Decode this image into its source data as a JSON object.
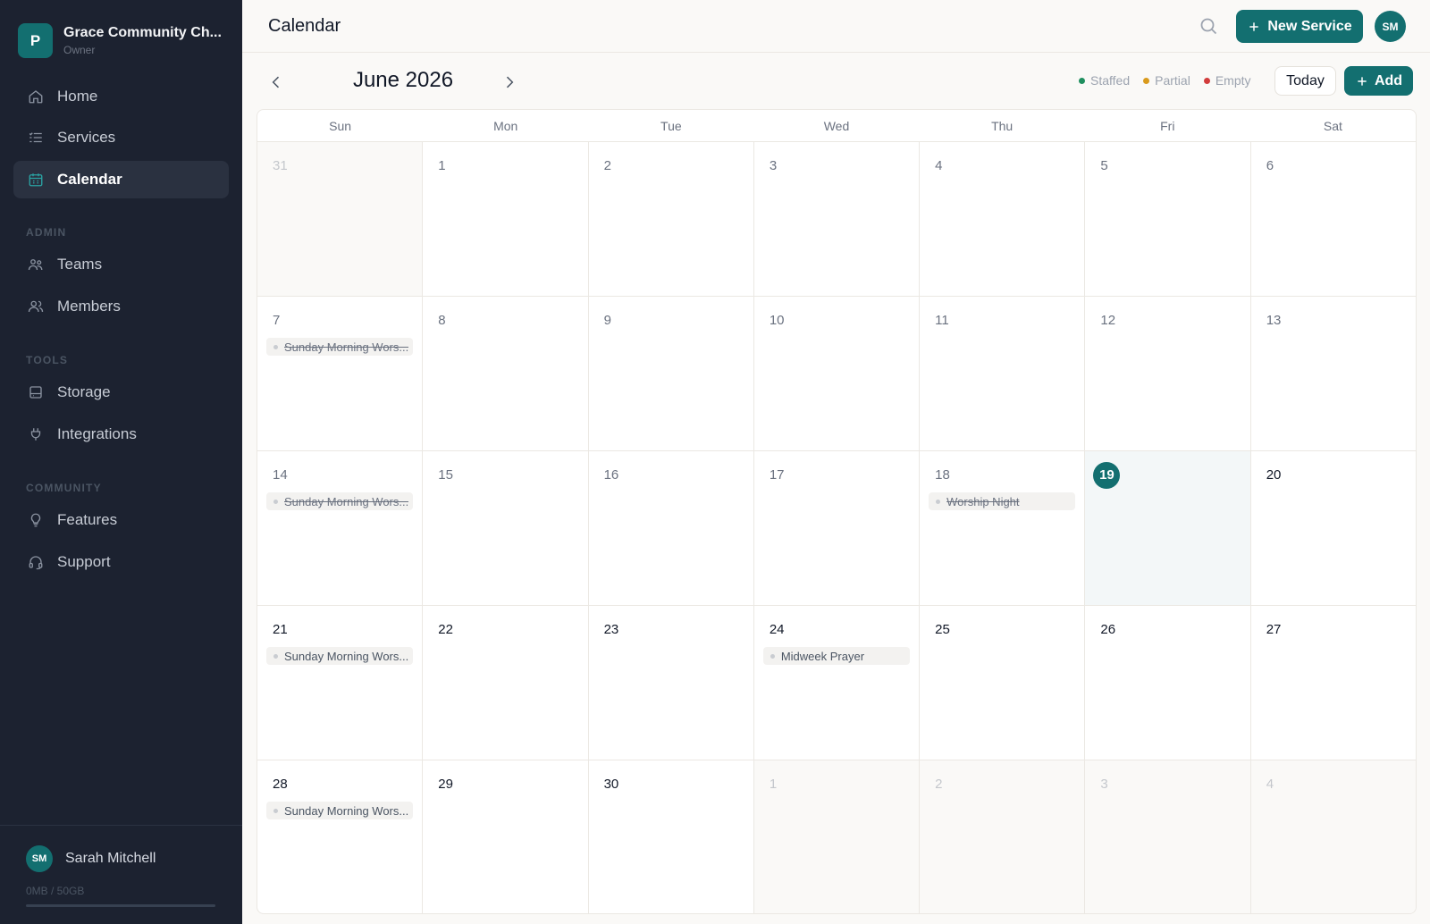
{
  "org": {
    "initial": "P",
    "name": "Grace Community Ch...",
    "role": "Owner"
  },
  "nav": {
    "home": "Home",
    "services": "Services",
    "calendar": "Calendar",
    "admin_label": "ADMIN",
    "teams": "Teams",
    "members": "Members",
    "tools_label": "TOOLS",
    "storage": "Storage",
    "integrations": "Integrations",
    "community_label": "COMMUNITY",
    "features": "Features",
    "support": "Support"
  },
  "user": {
    "initials": "SM",
    "name": "Sarah Mitchell",
    "storage": "0MB / 50GB",
    "storage_fraction": 0
  },
  "header": {
    "title": "Calendar",
    "new_service": "New Service",
    "avatar": "SM"
  },
  "toolbar": {
    "month": "June 2026",
    "legend": [
      {
        "label": "Staffed",
        "color": "#1f8f5f"
      },
      {
        "label": "Partial",
        "color": "#d99a1c"
      },
      {
        "label": "Empty",
        "color": "#d23c3c"
      }
    ],
    "today": "Today",
    "add": "Add"
  },
  "calendar": {
    "weekdays": [
      "Sun",
      "Mon",
      "Tue",
      "Wed",
      "Thu",
      "Fri",
      "Sat"
    ],
    "weeks": [
      [
        {
          "n": "31",
          "state": "outside"
        },
        {
          "n": "1",
          "state": "past"
        },
        {
          "n": "2",
          "state": "past"
        },
        {
          "n": "3",
          "state": "past"
        },
        {
          "n": "4",
          "state": "past"
        },
        {
          "n": "5",
          "state": "past"
        },
        {
          "n": "6",
          "state": "past"
        }
      ],
      [
        {
          "n": "7",
          "state": "past",
          "events": [
            {
              "title": "Sunday Morning Wors...",
              "past": true
            }
          ]
        },
        {
          "n": "8",
          "state": "past"
        },
        {
          "n": "9",
          "state": "past"
        },
        {
          "n": "10",
          "state": "past"
        },
        {
          "n": "11",
          "state": "past"
        },
        {
          "n": "12",
          "state": "past"
        },
        {
          "n": "13",
          "state": "past"
        }
      ],
      [
        {
          "n": "14",
          "state": "past",
          "events": [
            {
              "title": "Sunday Morning Wors...",
              "past": true
            }
          ]
        },
        {
          "n": "15",
          "state": "past"
        },
        {
          "n": "16",
          "state": "past"
        },
        {
          "n": "17",
          "state": "past"
        },
        {
          "n": "18",
          "state": "past",
          "events": [
            {
              "title": "Worship Night",
              "past": true
            }
          ]
        },
        {
          "n": "19",
          "state": "today"
        },
        {
          "n": "20",
          "state": "upcoming"
        }
      ],
      [
        {
          "n": "21",
          "state": "upcoming",
          "events": [
            {
              "title": "Sunday Morning Wors...",
              "past": false
            }
          ]
        },
        {
          "n": "22",
          "state": "upcoming"
        },
        {
          "n": "23",
          "state": "upcoming"
        },
        {
          "n": "24",
          "state": "upcoming",
          "events": [
            {
              "title": "Midweek Prayer",
              "past": false
            }
          ]
        },
        {
          "n": "25",
          "state": "upcoming"
        },
        {
          "n": "26",
          "state": "upcoming"
        },
        {
          "n": "27",
          "state": "upcoming"
        }
      ],
      [
        {
          "n": "28",
          "state": "upcoming",
          "events": [
            {
              "title": "Sunday Morning Wors...",
              "past": false
            }
          ]
        },
        {
          "n": "29",
          "state": "upcoming"
        },
        {
          "n": "30",
          "state": "upcoming"
        },
        {
          "n": "1",
          "state": "outside"
        },
        {
          "n": "2",
          "state": "outside"
        },
        {
          "n": "3",
          "state": "outside"
        },
        {
          "n": "4",
          "state": "outside"
        }
      ]
    ]
  }
}
